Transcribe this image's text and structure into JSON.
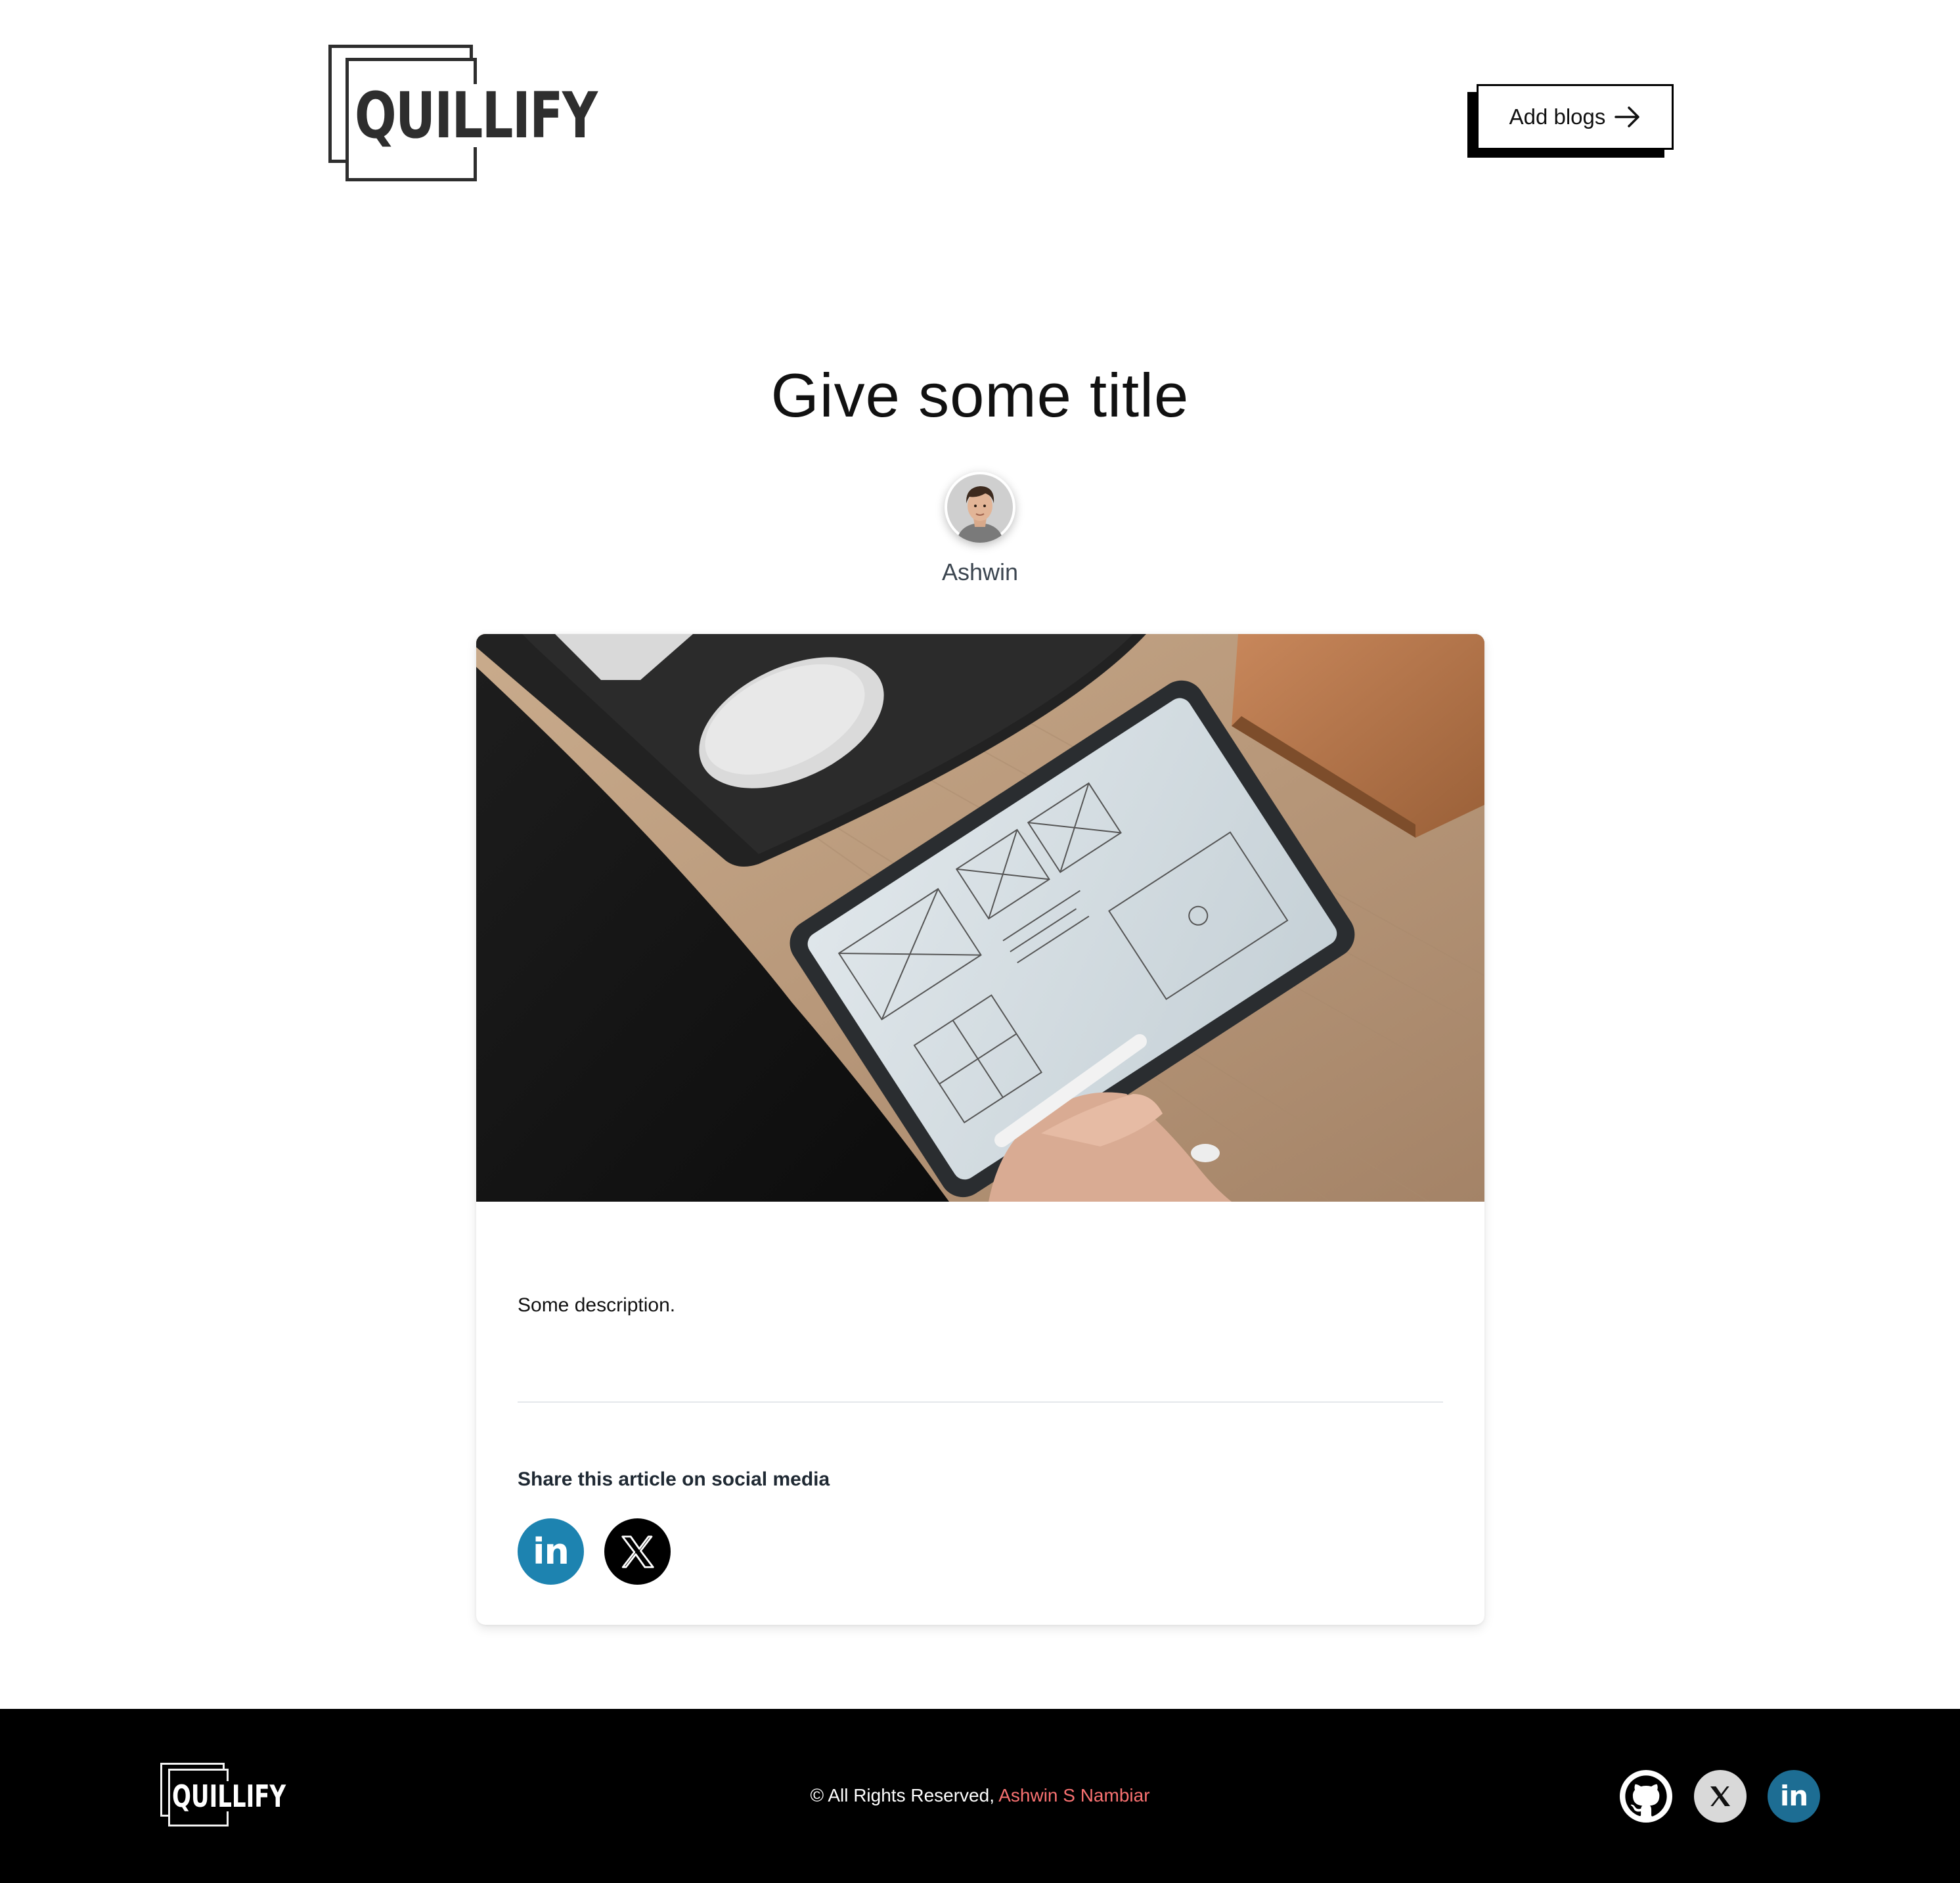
{
  "brand": {
    "logo_text": "QUILLIFY"
  },
  "header": {
    "add_blogs_label": "Add blogs"
  },
  "post": {
    "title": "Give some title",
    "author": "Ashwin",
    "description": "Some description.",
    "share_label": "Share this article on social media",
    "share_buttons": [
      {
        "name": "linkedin",
        "icon": "linkedin-icon",
        "glyph": "in",
        "color": "#1d83b0"
      },
      {
        "name": "x",
        "icon": "x-icon",
        "color": "#000000"
      }
    ]
  },
  "footer": {
    "logo_text": "QUILLIFY",
    "copyright_prefix": "© All Rights Reserved, ",
    "copyright_name": "Ashwin S Nambiar",
    "name_color": "#f87171",
    "social": [
      {
        "name": "github",
        "icon": "github-icon"
      },
      {
        "name": "x",
        "icon": "x-icon"
      },
      {
        "name": "linkedin",
        "icon": "linkedin-icon",
        "glyph": "in"
      }
    ]
  }
}
